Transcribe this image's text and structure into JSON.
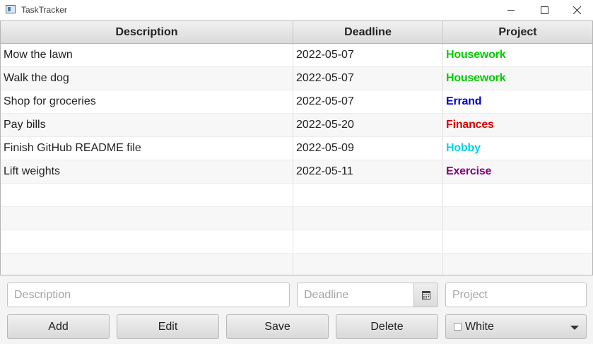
{
  "window": {
    "title": "TaskTracker"
  },
  "table": {
    "columns": [
      "Description",
      "Deadline",
      "Project"
    ],
    "rows": [
      {
        "description": "Mow the lawn",
        "deadline": "2022-05-07",
        "project": "Housework",
        "project_color": "#00cc00"
      },
      {
        "description": "Walk the dog",
        "deadline": "2022-05-07",
        "project": "Housework",
        "project_color": "#00cc00"
      },
      {
        "description": "Shop for groceries",
        "deadline": "2022-05-07",
        "project": "Errand",
        "project_color": "#0000cc"
      },
      {
        "description": "Pay bills",
        "deadline": "2022-05-20",
        "project": "Finances",
        "project_color": "#dd0000"
      },
      {
        "description": "Finish GitHub README file",
        "deadline": "2022-05-09",
        "project": "Hobby",
        "project_color": "#00d4e8"
      },
      {
        "description": "Lift weights",
        "deadline": "2022-05-11",
        "project": "Exercise",
        "project_color": "#800080"
      }
    ]
  },
  "form": {
    "description_placeholder": "Description",
    "deadline_placeholder": "Deadline",
    "project_placeholder": "Project",
    "calendar_icon": "calendar-icon"
  },
  "buttons": {
    "add": "Add",
    "edit": "Edit",
    "save": "Save",
    "delete": "Delete"
  },
  "color_picker": {
    "selected": "White",
    "swatch_color": "#ffffff"
  }
}
